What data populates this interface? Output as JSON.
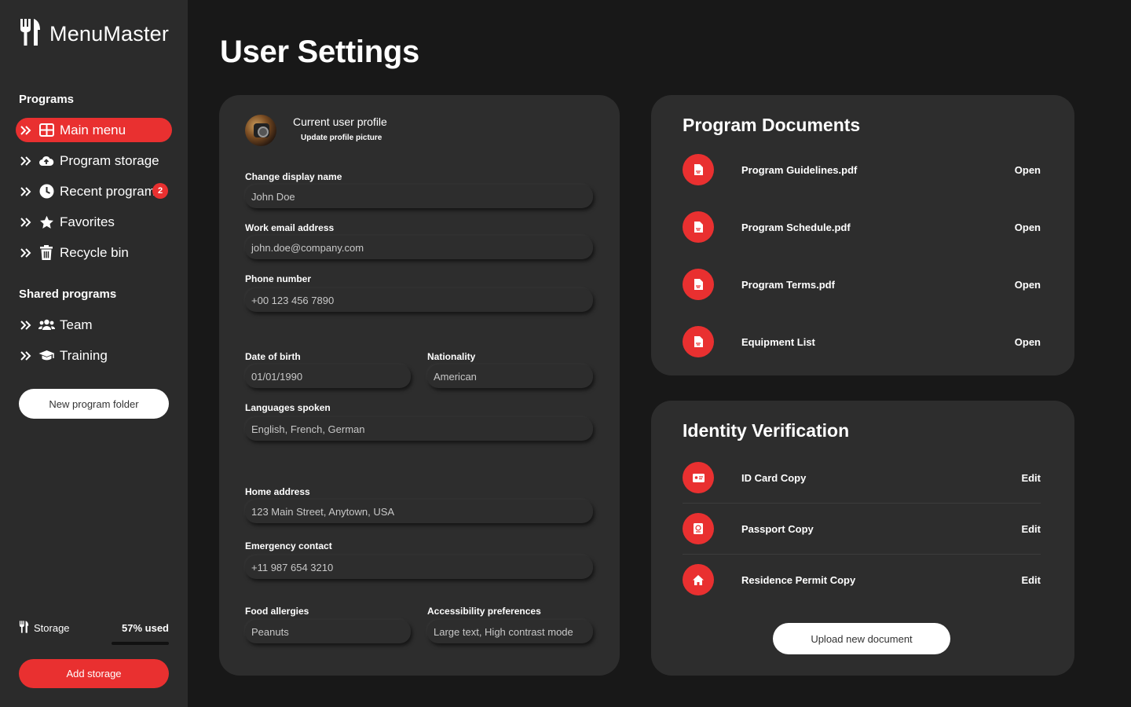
{
  "app": {
    "name": "MenuMaster"
  },
  "sidebar": {
    "programs_title": "Programs",
    "items": [
      {
        "label": "Main menu",
        "icon": "grid-icon",
        "active": true
      },
      {
        "label": "Program storage",
        "icon": "cloud-upload-icon"
      },
      {
        "label": "Recent programs",
        "icon": "clock-icon",
        "badge": "2"
      },
      {
        "label": "Favorites",
        "icon": "star-icon"
      },
      {
        "label": "Recycle bin",
        "icon": "trash-icon"
      }
    ],
    "shared_title": "Shared programs",
    "shared_items": [
      {
        "label": "Team",
        "icon": "users-icon"
      },
      {
        "label": "Training",
        "icon": "graduation-cap-icon"
      }
    ],
    "new_folder_label": "New program folder",
    "storage": {
      "label": "Storage",
      "used_text": "57% used",
      "used_fraction": 0.57
    },
    "add_storage_label": "Add storage"
  },
  "page": {
    "title": "User Settings"
  },
  "profile": {
    "heading": "Current user profile",
    "update_picture": "Update profile picture",
    "fields": {
      "display_name": {
        "label": "Change display name",
        "value": "John Doe"
      },
      "email": {
        "label": "Work email address",
        "value": "john.doe@company.com"
      },
      "phone": {
        "label": "Phone number",
        "value": "+00 123 456 7890"
      },
      "dob": {
        "label": "Date of birth",
        "value": "01/01/1990"
      },
      "nationality": {
        "label": "Nationality",
        "value": "American"
      },
      "languages": {
        "label": "Languages spoken",
        "value": "English, French, German"
      },
      "address": {
        "label": "Home address",
        "value": "123 Main Street, Anytown, USA"
      },
      "emergency": {
        "label": "Emergency contact",
        "value": "+11 987 654 3210"
      },
      "allergies": {
        "label": "Food allergies",
        "value": "Peanuts"
      },
      "accessibility": {
        "label": "Accessibility preferences",
        "value": "Large text, High contrast mode"
      }
    }
  },
  "documents": {
    "title": "Program Documents",
    "items": [
      {
        "name": "Program Guidelines.pdf",
        "action": "Open",
        "icon": "pdf-file-icon"
      },
      {
        "name": "Program Schedule.pdf",
        "action": "Open",
        "icon": "pdf-file-icon"
      },
      {
        "name": "Program Terms.pdf",
        "action": "Open",
        "icon": "pdf-file-icon"
      },
      {
        "name": "Equipment List",
        "action": "Open",
        "icon": "pdf-file-icon"
      }
    ]
  },
  "identity": {
    "title": "Identity Verification",
    "items": [
      {
        "name": "ID Card Copy",
        "action": "Edit",
        "icon": "id-card-icon"
      },
      {
        "name": "Passport Copy",
        "action": "Edit",
        "icon": "passport-icon"
      },
      {
        "name": "Residence Permit Copy",
        "action": "Edit",
        "icon": "home-icon"
      }
    ],
    "upload_label": "Upload new document"
  },
  "colors": {
    "accent": "#e93030",
    "sidebar_bg": "#2b2b2b",
    "page_bg": "#181818",
    "card_bg": "#2d2d2d"
  }
}
